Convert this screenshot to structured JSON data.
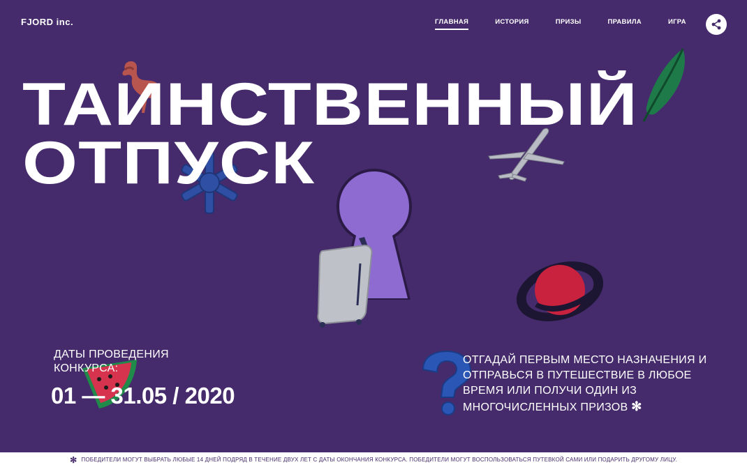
{
  "logo": "FJORD inc.",
  "nav": {
    "items": [
      {
        "label": "ГЛАВНАЯ",
        "active": true
      },
      {
        "label": "ИСТОРИЯ"
      },
      {
        "label": "ПРИЗЫ"
      },
      {
        "label": "ПРАВИЛА"
      },
      {
        "label": "ИГРА"
      }
    ]
  },
  "hero": {
    "title_line1": "ТАИНСТВЕННЫЙ",
    "title_line2": "ОТПУСК"
  },
  "dates": {
    "label": "ДАТЫ ПРОВЕДЕНИЯ КОНКУРСА:",
    "value": "01 — 31.05 / 2020"
  },
  "promo": {
    "text": "ОТГАДАЙ ПЕРВЫМ МЕСТО НАЗНАЧЕНИЯ И ОТПРАВЬСЯ В ПУТЕШЕСТВИЕ В ЛЮБОЕ ВРЕМЯ ИЛИ ПОЛУЧИ ОДИН ИЗ МНОГОЧИСЛЕННЫХ ПРИЗОВ",
    "asterisk": "✻"
  },
  "footer": {
    "asterisk": "✻",
    "text": "ПОБЕДИТЕЛИ МОГУТ ВЫБРАТЬ ЛЮБЫЕ 14 ДНЕЙ ПОДРЯД В ТЕЧЕНИЕ ДВУХ ЛЕТ С ДАТЫ ОКОНЧАНИЯ КОНКУРСА. ПОБЕДИТЕЛИ МОГУТ ВОСПОЛЬЗОВАТЬСЯ ПУТЕВКОЙ САМИ ИЛИ ПОДАРИТЬ ДРУГОМУ ЛИЦУ."
  },
  "colors": {
    "background": "#452b6b",
    "keyhole": "#8d6bd0",
    "text": "#ffffff"
  },
  "icons": [
    "share-icon",
    "flamingo-icon",
    "snowflake-icon",
    "feather-icon",
    "airplane-icon",
    "keyhole-icon",
    "suitcase-icon",
    "planet-icon",
    "watermelon-icon",
    "question-mark-icon"
  ]
}
